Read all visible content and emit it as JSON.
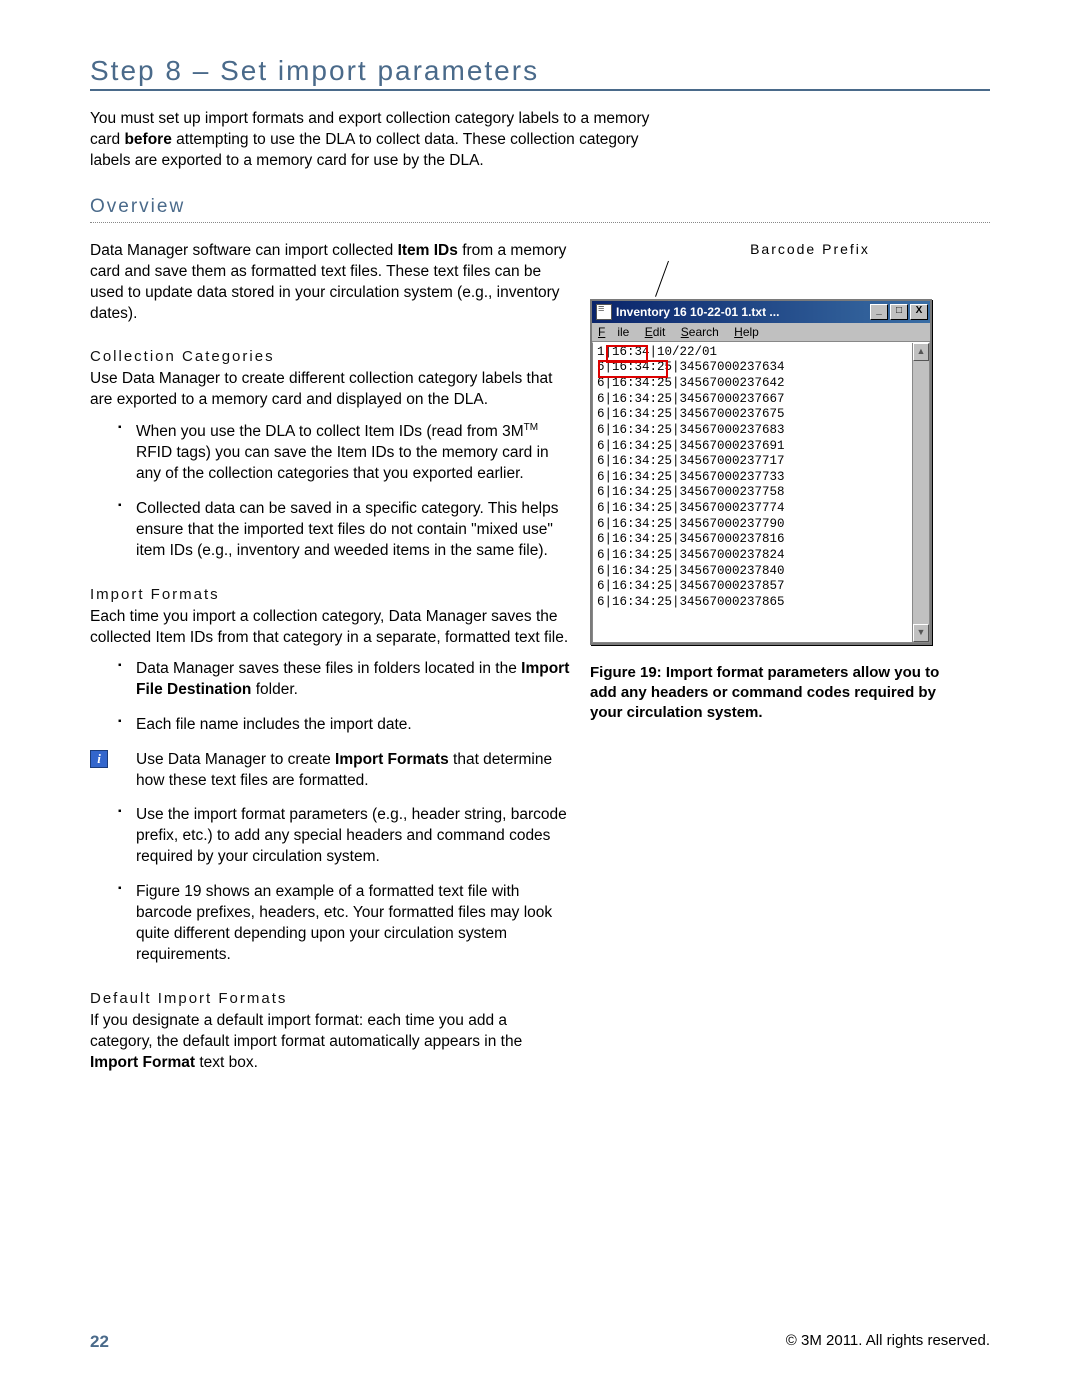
{
  "heading": "Step 8 – Set import parameters",
  "intro_before_bold": "You must set up import formats and export collection category labels to a memory card ",
  "intro_bold": "before",
  "intro_after_bold": " attempting to use the DLA to collect data. These collection category labels are exported to a memory card for use by the DLA.",
  "overview_heading": "Overview",
  "overview_p1_a": "Data Manager software can import collected ",
  "overview_p1_b": "Item IDs",
  "overview_p1_c": " from a memory card and save them as formatted text files. These text files can be used to update data stored in your circulation system (e.g., inventory dates).",
  "cc_heading": "Collection Categories",
  "cc_para": "Use Data Manager to create different collection category labels that are exported to a memory card and displayed on the DLA.",
  "cc_b1_a": "When you use the DLA to collect Item IDs (read from 3M",
  "cc_b1_b": " RFID tags) you can save the Item IDs to the memory card in any of the collection categories that you exported earlier.",
  "cc_b2": "Collected data can be saved in a specific category. This helps ensure that the imported text files do not contain \"mixed use\" item IDs (e.g., inventory and weeded items in the same file).",
  "if_heading": "Import Formats",
  "if_para": "Each time you import a collection category, Data Manager saves the collected Item IDs from that category in a separate, formatted text file.",
  "if_b1_a": "Data Manager saves these files in folders located in the ",
  "if_b1_b": "Import File Destination",
  "if_b1_c": " folder.",
  "if_b2": "Each file name includes the import date.",
  "if_b3_a": "Use Data Manager to create ",
  "if_b3_b": "Import Formats",
  "if_b3_c": " that determine how these text files are formatted.",
  "if_b4": "Use the import format parameters (e.g., header string, barcode prefix, etc.) to add any special headers and command codes required by your circulation system.",
  "if_b5": "Figure 19 shows an example of a formatted text file with barcode prefixes, headers, etc. Your formatted files may look quite different depending upon your circulation system requirements.",
  "dif_heading": "Default Import Formats",
  "dif_a": "If you designate a default import format: each time you add a category, the default import format automatically appears in the ",
  "dif_b": "Import Format",
  "dif_c": " text box.",
  "barcode_label": "Barcode Prefix",
  "win_title": "Inventory 16 10-22-01 1.txt ...",
  "menu_file": "File",
  "menu_edit": "Edit",
  "menu_search": "Search",
  "menu_help": "Help",
  "text_lines": [
    "1|16:34|10/22/01",
    "6|16:34:25|34567000237634",
    "6|16:34:25|34567000237642",
    "6|16:34:25|34567000237667",
    "6|16:34:25|34567000237675",
    "6|16:34:25|34567000237683",
    "6|16:34:25|34567000237691",
    "6|16:34:25|34567000237717",
    "6|16:34:25|34567000237733",
    "6|16:34:25|34567000237758",
    "6|16:34:25|34567000237774",
    "6|16:34:25|34567000237790",
    "6|16:34:25|34567000237816",
    "6|16:34:25|34567000237824",
    "6|16:34:25|34567000237840",
    "6|16:34:25|34567000237857",
    "6|16:34:25|34567000237865"
  ],
  "figure_caption": "Figure 19: Import format parameters allow you to add any headers or command codes required by your circulation system.",
  "page_number": "22",
  "copyright": "© 3M 2011. All rights reserved.",
  "tm": "TM"
}
